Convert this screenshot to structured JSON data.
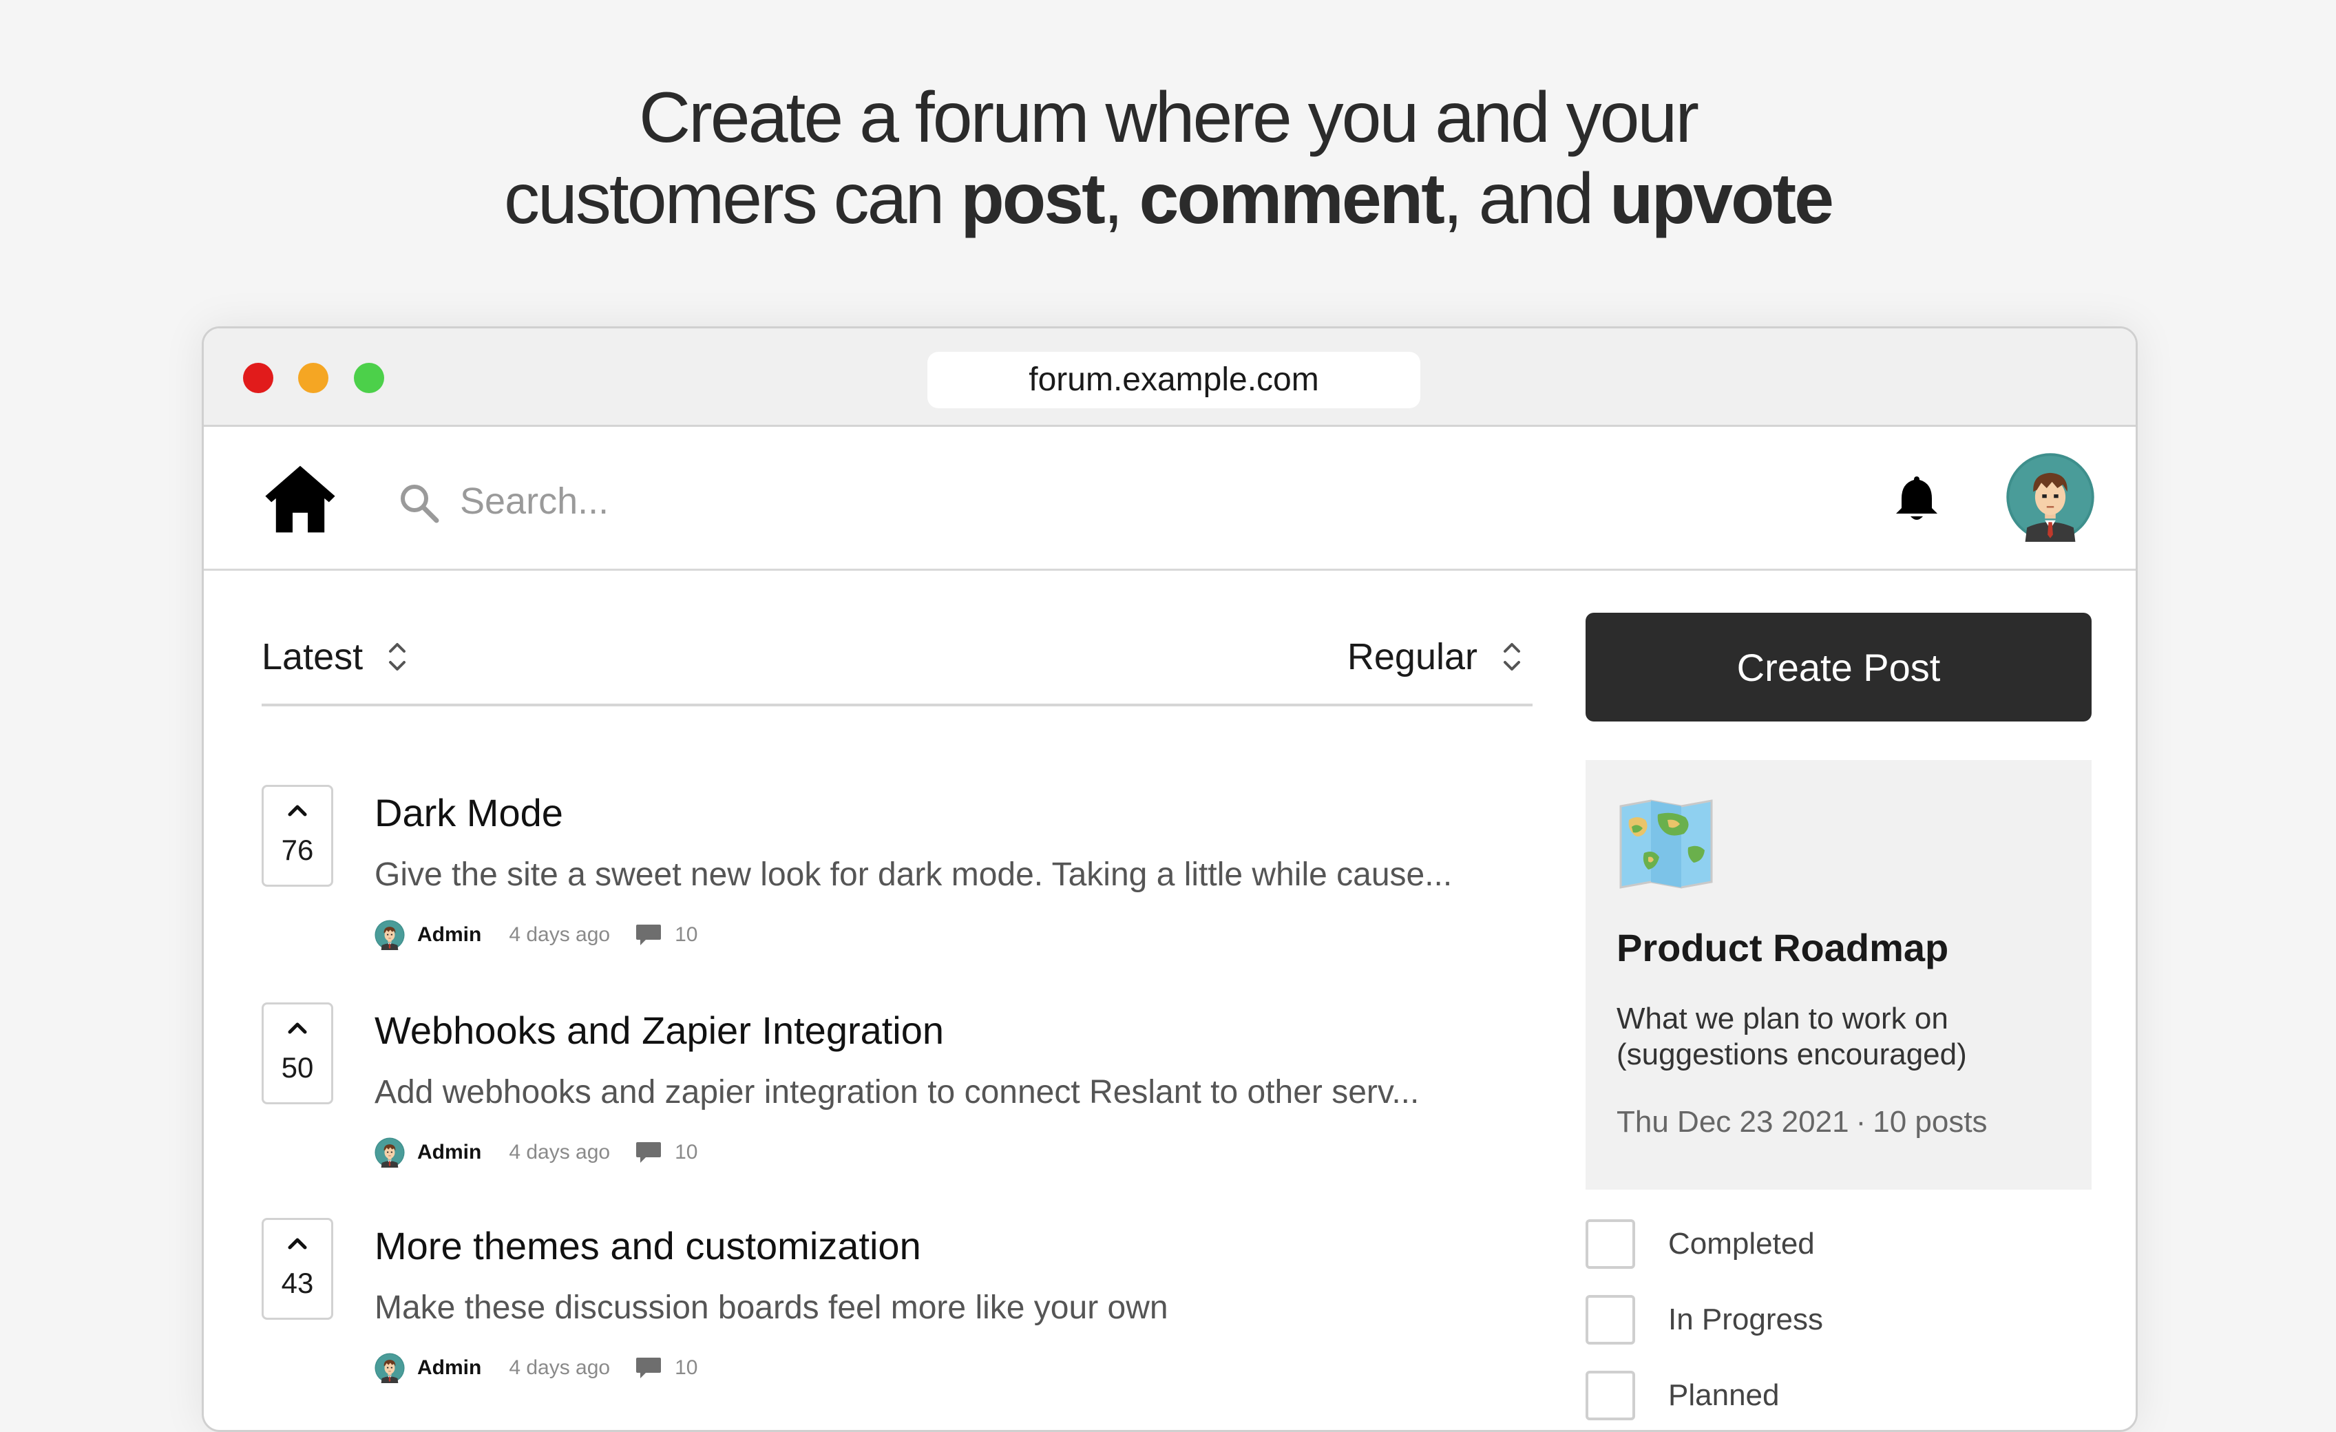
{
  "headline": {
    "line1": "Create a forum where you and your",
    "line2_prefix": "customers can ",
    "word_post": "post",
    "sep1": ", ",
    "word_comment": "comment",
    "sep2": ", and ",
    "word_upvote": "upvote"
  },
  "browser": {
    "url": "forum.example.com"
  },
  "navbar": {
    "search_placeholder": "Search..."
  },
  "sort": {
    "order": "Latest",
    "view": "Regular"
  },
  "create_post_label": "Create Post",
  "posts": [
    {
      "votes": "76",
      "title": "Dark Mode",
      "body": "Give the site a sweet new look for dark mode. Taking a little while cause...",
      "author": "Admin",
      "age": "4 days ago",
      "comments": "10"
    },
    {
      "votes": "50",
      "title": "Webhooks and Zapier Integration",
      "body": "Add webhooks and zapier integration to connect Reslant to other serv...",
      "author": "Admin",
      "age": "4 days ago",
      "comments": "10"
    },
    {
      "votes": "43",
      "title": "More themes and customization",
      "body": "Make these discussion boards feel more like your own",
      "author": "Admin",
      "age": "4 days ago",
      "comments": "10"
    }
  ],
  "roadmap": {
    "title": "Product Roadmap",
    "description": "What we plan to work on (suggestions encouraged)",
    "date": "Thu Dec 23 2021",
    "separator": "·",
    "post_count": "10 posts"
  },
  "filters": [
    {
      "label": "Completed"
    },
    {
      "label": "In Progress"
    },
    {
      "label": "Planned"
    }
  ],
  "colors": {
    "accent_dark": "#2c2c2c",
    "traffic_red": "#e11b1b",
    "traffic_yellow": "#f5a623",
    "traffic_green": "#4cd04a"
  },
  "icons": [
    "home-icon",
    "search-icon",
    "bell-icon",
    "avatar",
    "chevron-up-down-icon",
    "upvote-chevron-icon",
    "comment-icon",
    "map-icon"
  ]
}
